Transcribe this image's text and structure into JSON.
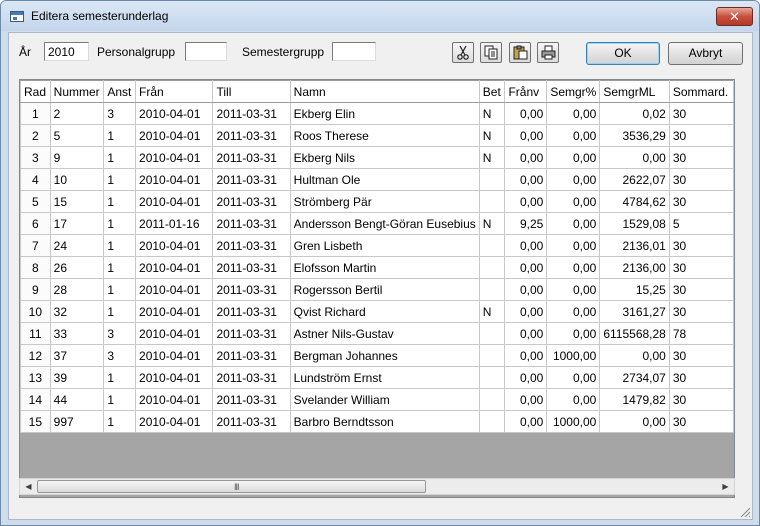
{
  "window": {
    "title": "Editera semesterunderlag",
    "close_glyph": "✕",
    "colors": {
      "frame": "#cfdcec",
      "close": "#c7503d",
      "empty_area": "#a5a5a5"
    }
  },
  "filters": {
    "year_label": "År",
    "year_value": "2010",
    "personalgroup_label": "Personalgrupp",
    "personalgroup_value": "",
    "semestergroup_label": "Semestergrupp",
    "semestergroup_value": ""
  },
  "toolbar": {
    "icons": [
      "scissors-icon",
      "copy-icon",
      "paste-icon",
      "print-icon"
    ],
    "ok_label": "OK",
    "cancel_label": "Avbryt"
  },
  "table": {
    "columns": [
      "Rad",
      "Nummer",
      "Anst",
      "Från",
      "Till",
      "Namn",
      "Bet",
      "Frånv",
      "Semgr%",
      "SemgrML",
      "Sommard."
    ],
    "rows": [
      [
        "1",
        "2",
        "3",
        "2010-04-01",
        "2011-03-31",
        "Ekberg Elin",
        "N",
        "0,00",
        "0,00",
        "0,02",
        "30"
      ],
      [
        "2",
        "5",
        "1",
        "2010-04-01",
        "2011-03-31",
        "Roos Therese",
        "N",
        "0,00",
        "0,00",
        "3536,29",
        "30"
      ],
      [
        "3",
        "9",
        "1",
        "2010-04-01",
        "2011-03-31",
        "Ekberg Nils",
        "N",
        "0,00",
        "0,00",
        "0,00",
        "30"
      ],
      [
        "4",
        "10",
        "1",
        "2010-04-01",
        "2011-03-31",
        "Hultman Ole",
        "",
        "0,00",
        "0,00",
        "2622,07",
        "30"
      ],
      [
        "5",
        "15",
        "1",
        "2010-04-01",
        "2011-03-31",
        "Strömberg Pär",
        "",
        "0,00",
        "0,00",
        "4784,62",
        "30"
      ],
      [
        "6",
        "17",
        "1",
        "2011-01-16",
        "2011-03-31",
        "Andersson Bengt-Göran Eusebius",
        "N",
        "9,25",
        "0,00",
        "1529,08",
        "5"
      ],
      [
        "7",
        "24",
        "1",
        "2010-04-01",
        "2011-03-31",
        "Gren Lisbeth",
        "",
        "0,00",
        "0,00",
        "2136,01",
        "30"
      ],
      [
        "8",
        "26",
        "1",
        "2010-04-01",
        "2011-03-31",
        "Elofsson Martin",
        "",
        "0,00",
        "0,00",
        "2136,00",
        "30"
      ],
      [
        "9",
        "28",
        "1",
        "2010-04-01",
        "2011-03-31",
        "Rogersson Bertil",
        "",
        "0,00",
        "0,00",
        "15,25",
        "30"
      ],
      [
        "10",
        "32",
        "1",
        "2010-04-01",
        "2011-03-31",
        "Qvist Richard",
        "N",
        "0,00",
        "0,00",
        "3161,27",
        "30"
      ],
      [
        "11",
        "33",
        "3",
        "2010-04-01",
        "2011-03-31",
        "Astner Nils-Gustav",
        "",
        "0,00",
        "0,00",
        "6115568,28",
        "78"
      ],
      [
        "12",
        "37",
        "3",
        "2010-04-01",
        "2011-03-31",
        "Bergman Johannes",
        "",
        "0,00",
        "1000,00",
        "0,00",
        "30"
      ],
      [
        "13",
        "39",
        "1",
        "2010-04-01",
        "2011-03-31",
        "Lundström Ernst",
        "",
        "0,00",
        "0,00",
        "2734,07",
        "30"
      ],
      [
        "14",
        "44",
        "1",
        "2010-04-01",
        "2011-03-31",
        "Svelander William",
        "",
        "0,00",
        "0,00",
        "1479,82",
        "30"
      ],
      [
        "15",
        "997",
        "1",
        "2010-04-01",
        "2011-03-31",
        "Barbro Berndtsson",
        "",
        "0,00",
        "1000,00",
        "0,00",
        "30"
      ]
    ]
  },
  "scrollbar": {
    "left_glyph": "◀",
    "right_glyph": "▶",
    "grip_glyph": "III",
    "thumb_fraction": 0.57
  }
}
